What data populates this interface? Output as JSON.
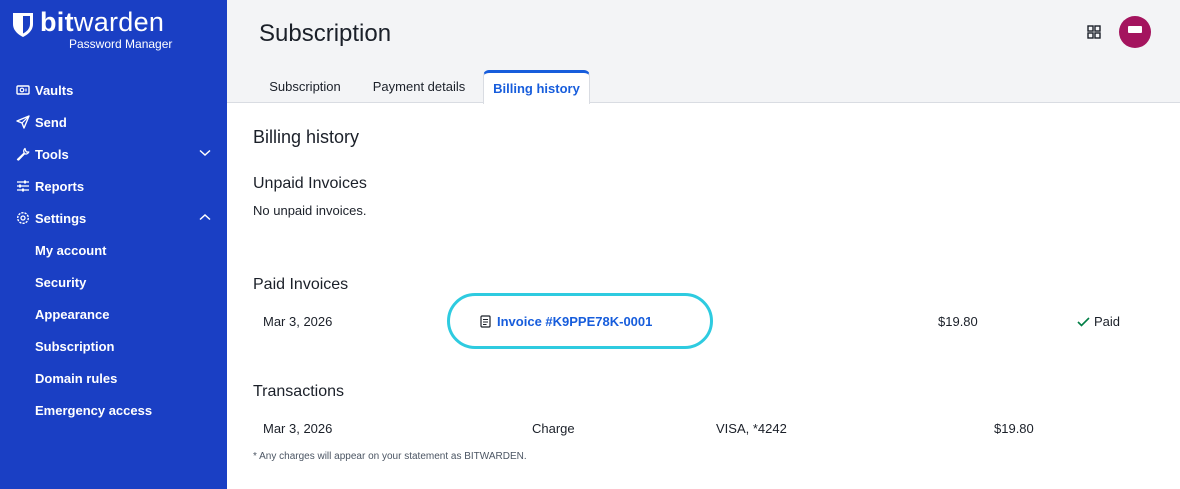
{
  "brand": {
    "name_bold": "bit",
    "name_rest": "warden",
    "subtitle": "Password Manager"
  },
  "sidebar": {
    "items": [
      {
        "label": "Vaults",
        "icon": "vault-icon"
      },
      {
        "label": "Send",
        "icon": "send-icon"
      },
      {
        "label": "Tools",
        "icon": "wrench-icon",
        "expand": "chevron-down-icon"
      },
      {
        "label": "Reports",
        "icon": "sliders-icon"
      },
      {
        "label": "Settings",
        "icon": "gear-icon",
        "expand": "chevron-up-icon"
      }
    ],
    "settings_children": [
      "My account",
      "Security",
      "Appearance",
      "Subscription",
      "Domain rules",
      "Emergency access"
    ]
  },
  "header": {
    "title": "Subscription",
    "tabs": [
      "Subscription",
      "Payment details",
      "Billing history"
    ],
    "active_tab": "Billing history"
  },
  "main": {
    "heading": "Billing history",
    "unpaid": {
      "heading": "Unpaid Invoices",
      "empty": "No unpaid invoices."
    },
    "paid": {
      "heading": "Paid Invoices",
      "rows": [
        {
          "date": "Mar 3, 2026",
          "invoice": "Invoice #K9PPE78K-0001",
          "amount": "$19.80",
          "status": "Paid"
        }
      ]
    },
    "transactions": {
      "heading": "Transactions",
      "rows": [
        {
          "date": "Mar 3, 2026",
          "type": "Charge",
          "method": "VISA, *4242",
          "amount": "$19.80"
        }
      ],
      "note": "* Any charges will appear on your statement as BITWARDEN."
    }
  },
  "colors": {
    "sidebar": "#1a3fc4",
    "accent": "#175ddc",
    "highlight": "#2ecbe0",
    "avatar": "#a4145e",
    "paid_check": "#017e45"
  }
}
